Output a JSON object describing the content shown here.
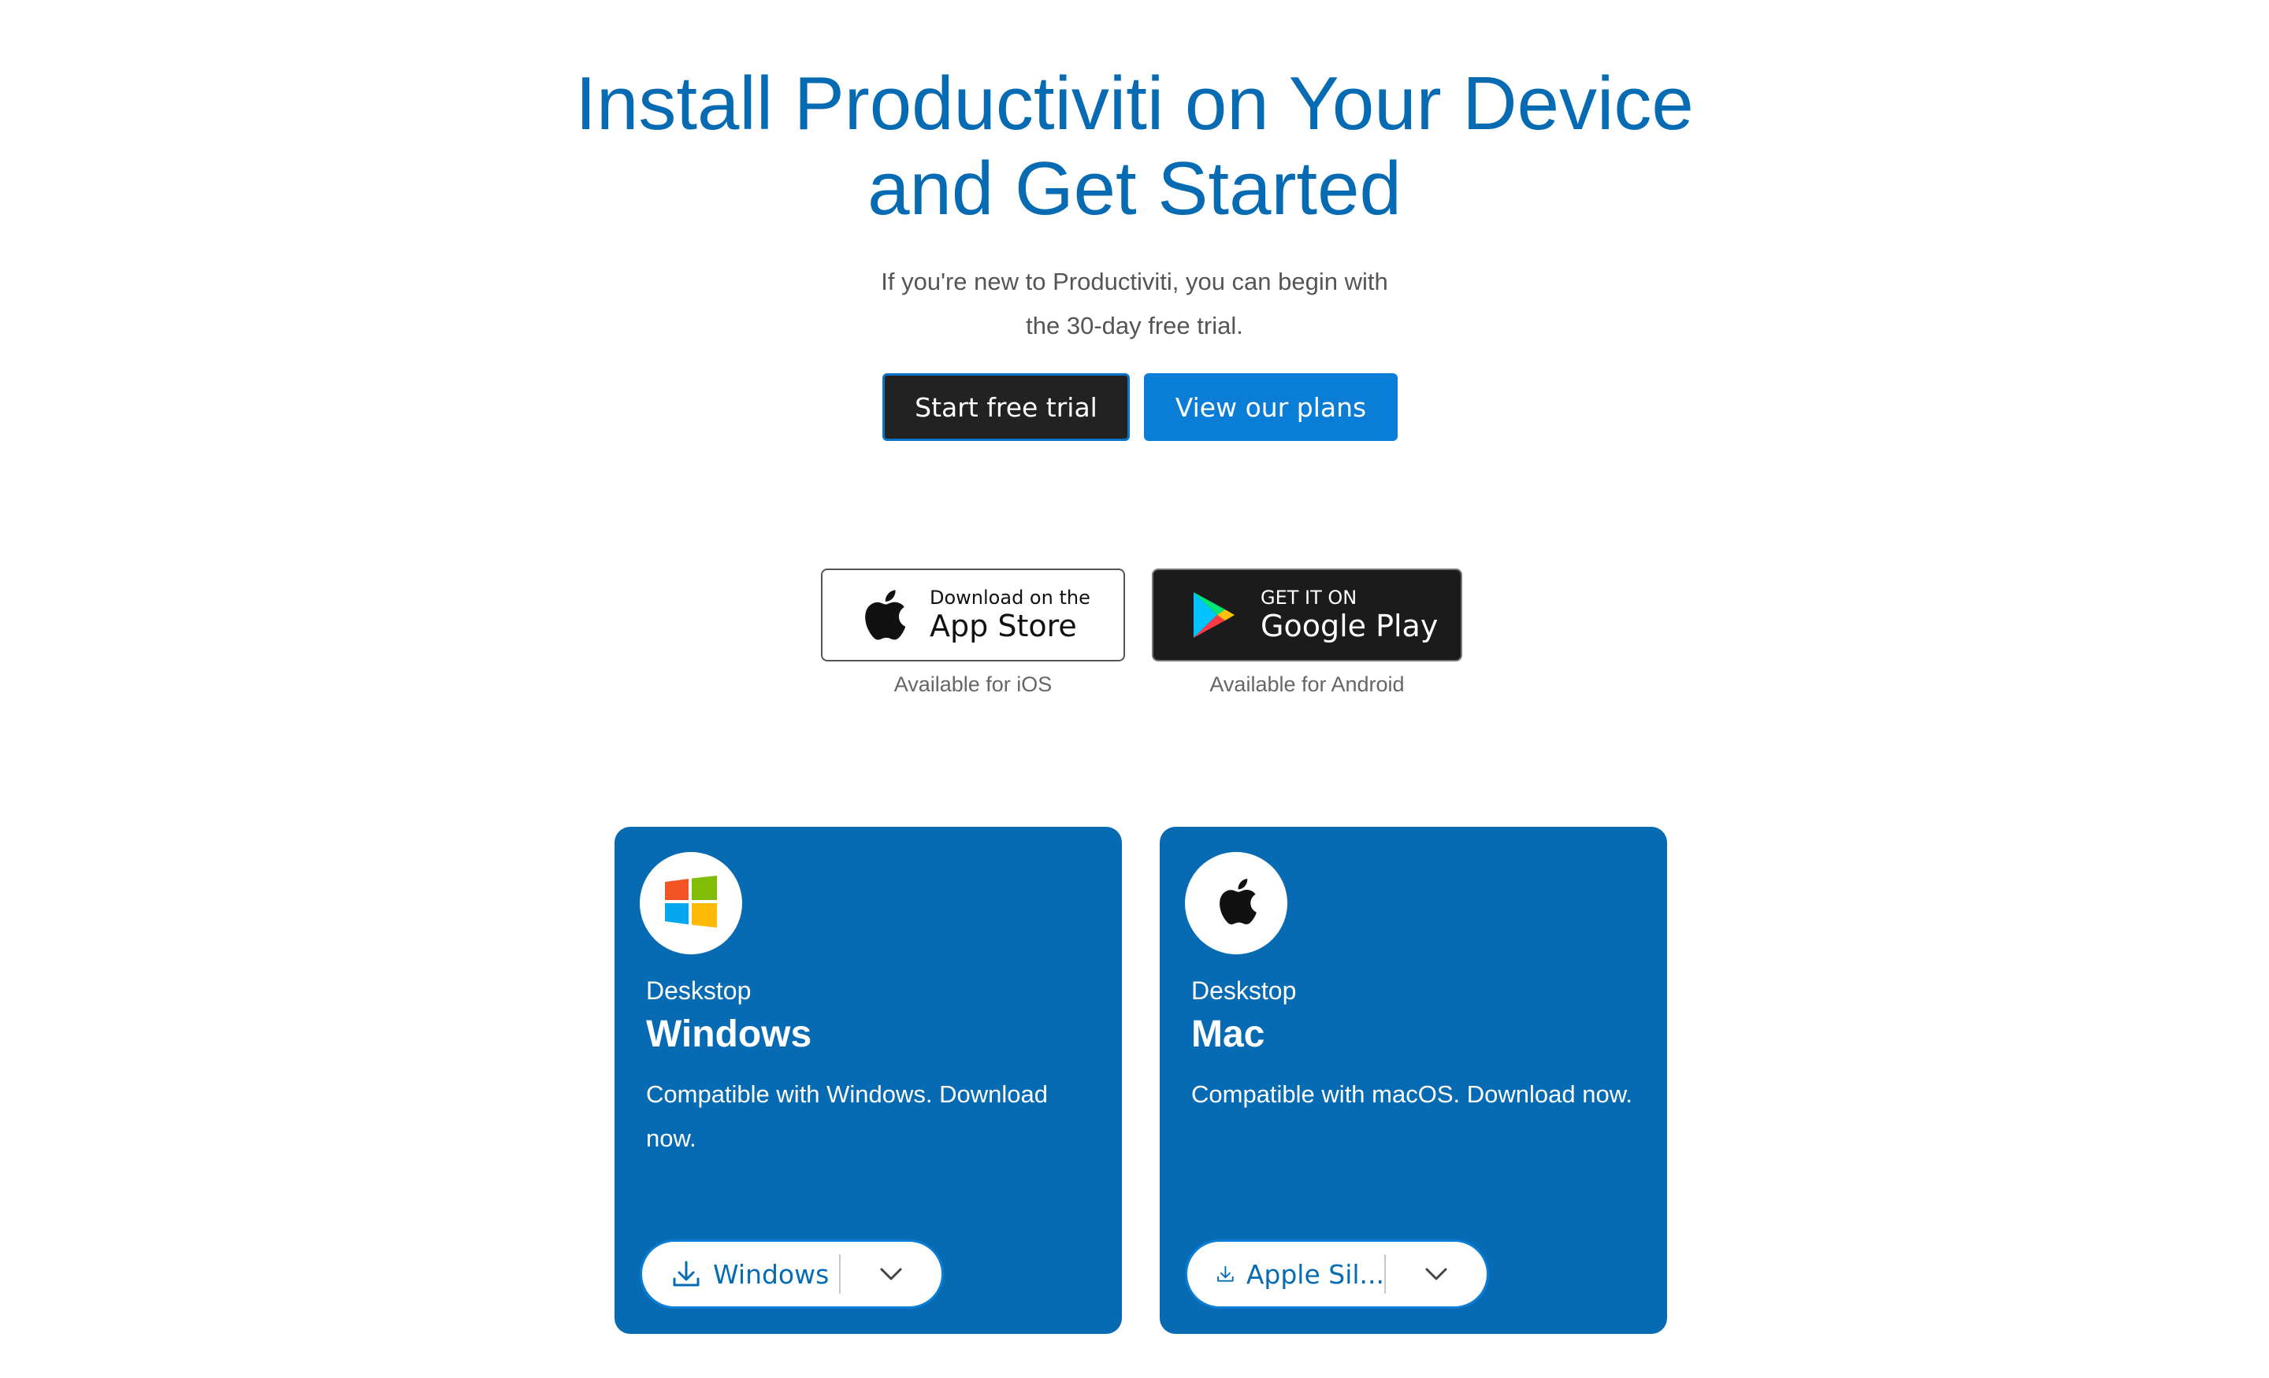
{
  "hero": {
    "title_line1": "Install Productiviti on Your Device",
    "title_line2": "and Get Started",
    "subtitle_line1": "If you're new to Productiviti, you can begin with",
    "subtitle_line2": "the 30-day free trial.",
    "primary_cta": "Start free trial",
    "secondary_cta": "View our plans"
  },
  "stores": {
    "apple": {
      "small_text": "Download on the",
      "large_text": "App Store",
      "caption": "Available for iOS",
      "icon": "apple-icon"
    },
    "google": {
      "small_text": "GET IT ON",
      "large_text": "Google Play",
      "caption": "Available for Android",
      "icon": "google-play-icon"
    }
  },
  "cards": {
    "windows": {
      "label": "Deskstop",
      "title": "Windows",
      "description": "Compatible with Windows. Download now.",
      "download_label": "Windows",
      "icon": "windows-icon"
    },
    "mac": {
      "label": "Deskstop",
      "title": "Mac",
      "description": "Compatible with macOS. Download now.",
      "download_label": "Apple Sil...",
      "icon": "apple-icon"
    }
  },
  "colors": {
    "brand_blue": "#066bb3",
    "button_blue": "#0a7ed6",
    "dark_button": "#222222"
  }
}
